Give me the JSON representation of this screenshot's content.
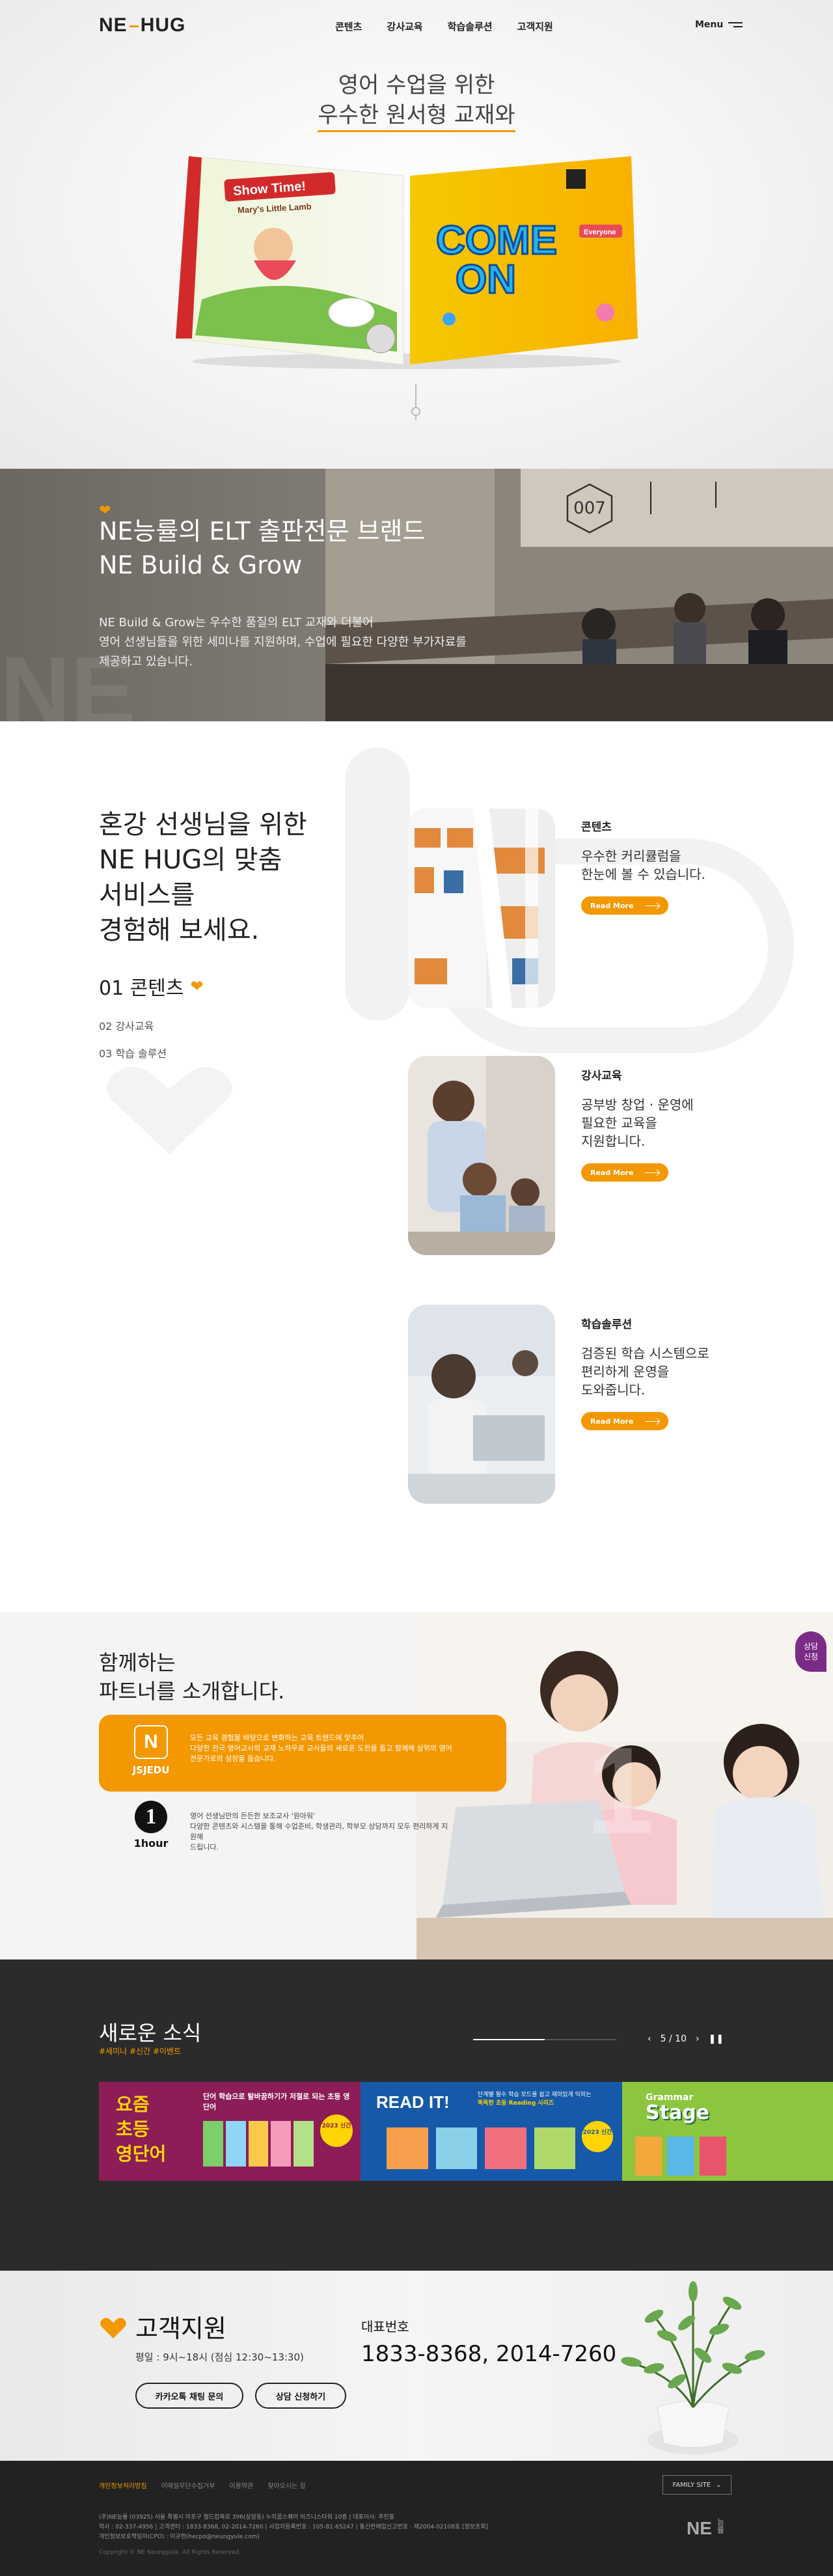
{
  "header": {
    "logo_text": "NE",
    "logo_text2": "HUG",
    "nav": [
      "콘텐츠",
      "강사교육",
      "학습솔루션",
      "고객지원"
    ],
    "menu_label": "Menu"
  },
  "hero": {
    "title_line1": "영어 수업을 위한",
    "title_line2": "우수한 원서형 교재와",
    "book_left_title": "Show Time!",
    "book_left_sub": "Mary's Little Lamb",
    "book_right_title1": "COME",
    "book_right_title2": "ON",
    "book_right_badge": "Everyone"
  },
  "brand": {
    "title_line1": "NE능률의 ELT 출판전문 브랜드",
    "title_line2": "NE Build & Grow",
    "desc_line1": "NE Build & Grow는 우수한 품질의 ELT 교재와 더불어",
    "desc_line2": "영어 선생님들을 위한 세미나를 지원하며, 수업에 필요한 다양한 부가자료를",
    "desc_line3": "제공하고 있습니다.",
    "badge": "007",
    "watermark": "NE"
  },
  "services": {
    "heading_line1": "혼강 선생님을 위한",
    "heading_line2": "NE HUG의 맞춤",
    "heading_line3": "서비스를",
    "heading_line4": "경험해 보세요.",
    "tab1": "01 콘텐츠",
    "tab2": "02 강사교육",
    "tab3": "03 학습 솔루션",
    "more_label": "Read More",
    "items": [
      {
        "name": "콘텐츠",
        "text_line1": "우수한 커리큘럼을",
        "text_line2": "한눈에 볼 수 있습니다.",
        "text_line3": ""
      },
      {
        "name": "강사교육",
        "text_line1": "공부방 창업 · 운영에",
        "text_line2": "필요한 교육을",
        "text_line3": "지원합니다."
      },
      {
        "name": "학습솔루션",
        "text_line1": "검증된 학습 시스템으로",
        "text_line2": "편리하게 운영을",
        "text_line3": "도와줍니다."
      }
    ]
  },
  "partners": {
    "heading_line1": "함께하는",
    "heading_line2": "파트너를 소개합니다.",
    "consult_line1": "상담",
    "consult_line2": "신청",
    "p1_logo": "N",
    "p1_name": "JSJEDU",
    "p1_text_line1": "모든 교육 경험을 바탕으로 변화하는 교육 트렌드에 맞추어",
    "p1_text_line2": "다양한 전국 영어교사의 교재 노하우로 교사들의 새로운 도전을 돕고 함께해 상위의 영어",
    "p1_text_line3": "전문가로의 성장을 돕습니다.",
    "p2_logo": "1",
    "p2_name": "1hour",
    "p2_text_line1": "영어 선생님만의 든든한 보조교사 '원아워'",
    "p2_text_line2": "다양한 콘텐츠와 시스템을 통해 수업준비, 학생관리, 학부모 상담까지 모두 편리하게 지원해",
    "p2_text_line3": "드립니다."
  },
  "news": {
    "title": "새로운 소식",
    "subtitle": "#세미나 #신간 #이벤트",
    "pager_current": "5",
    "pager_total": "10",
    "pager_sep": "/",
    "banners": [
      {
        "title_line1": "요즘",
        "title_line2": "초등",
        "title_line3": "영단어",
        "caption": "단어 학습으로 탈바꿈하기가 저절로 되는 초등 영단어",
        "badge": "2023 신간"
      },
      {
        "title": "READ IT!",
        "caption_line1": "단계별 필수 학습 모드를 쉽고 재미있게 익히는",
        "caption_line2": "똑똑한 초등 Reading 시리즈",
        "badge": "2023 신간"
      },
      {
        "title1": "Grammar",
        "title2": "Stage"
      }
    ]
  },
  "support": {
    "title": "고객지원",
    "hours": "평일 : 9시~18시 (점심 12:30~13:30)",
    "btn_chat": "카카오톡 채팅 문의",
    "btn_consult": "상담 신청하기",
    "phone_label": "대표번호",
    "phone": "1833-8368,  2014-7260"
  },
  "footer": {
    "links": [
      "개인정보처리방침",
      "이메일무단수집거부",
      "이용약관",
      "찾아오시는 길"
    ],
    "family_site": "FAMILY SITE",
    "info_line1": "(주)NE능률 (03925) 서울 특별시 마포구 월드컵북로 396(상암동) 누리꿈스퀘어 비즈니스타워 10층  |  대표이사: 주민홍",
    "info_line2": "학사 : 02-337-4956  |  고객센터 : 1833-8368, 02-2014-7260  |  사업자등록번호 : 105-81-65247  |  통신판매업신고번호 : 제2004-02108호  [정보조회]",
    "info_line3": "개인정보보호책임자(CPO) : 이규현(hecpo@neungyule.com)",
    "copyright": "Copyright © NE Neungyule. All Rights Reserved.",
    "logo": "NE",
    "logo_vertical": "능률"
  },
  "colors": {
    "accent": "#f39800",
    "purple": "#7b2b86",
    "dark": "#2b2b2b"
  }
}
